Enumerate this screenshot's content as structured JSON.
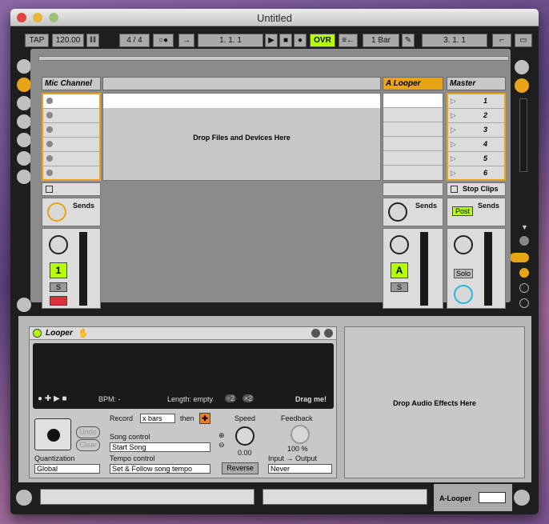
{
  "window": {
    "title": "Untitled"
  },
  "control_bar": {
    "tap": "TAP",
    "tempo": "120.00",
    "sig": "4 / 4",
    "position": "1.   1.   1",
    "ovr": "OVR",
    "quantize": "1 Bar",
    "loop_pos": "3.   1.   1"
  },
  "tracks": {
    "mic": "Mic Channel",
    "looper": "A Looper",
    "master": "Master",
    "drop_files": "Drop Files and Devices Here",
    "scenes": [
      "1",
      "2",
      "3",
      "4",
      "5",
      "6"
    ],
    "stop_clips": "Stop Clips",
    "sends": "Sends",
    "post": "Post",
    "track_num": "1",
    "s": "S",
    "a": "A",
    "solo": "Solo",
    "a_small": "A"
  },
  "device": {
    "name": "Looper",
    "bpm": "BPM: -",
    "length": "Length: empty",
    "x2a": "÷2",
    "x2b": "×2",
    "drag": "Drag me!",
    "record": "Record",
    "x_bars": "x bars",
    "then": "then",
    "undo": "Undo",
    "clear": "Clear",
    "song_control": "Song control",
    "start_song": "Start Song",
    "tempo_control": "Tempo control",
    "tempo_opt": "Set & Follow song tempo",
    "quantization": "Global",
    "quant_label": "Quantization",
    "speed": "Speed",
    "speed_val": "0.00",
    "reverse": "Reverse",
    "feedback": "Feedback",
    "feedback_val": "100 %",
    "io": "Input → Output",
    "io_val": "Never",
    "drop_audio": "Drop Audio Effects Here"
  },
  "status": {
    "track": "A-Looper"
  },
  "colors": {
    "accent": "#e8a317",
    "lime": "#b6ff00",
    "orange_btn": "#f08020"
  }
}
